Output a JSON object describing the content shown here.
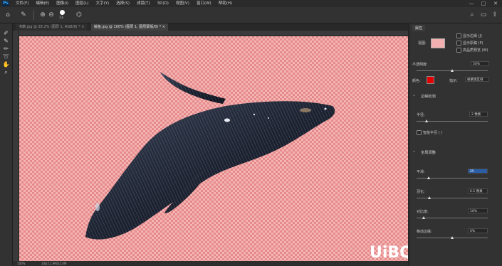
{
  "menubar": {
    "logo": "Ps",
    "items": [
      "文件(F)",
      "编辑(E)",
      "图像(I)",
      "图层(L)",
      "文字(Y)",
      "选择(S)",
      "滤镜(T)",
      "3D(D)",
      "视图(V)",
      "窗口(W)",
      "帮助(H)"
    ],
    "minimize": "—",
    "maximize": "□",
    "close": "✕"
  },
  "options": {
    "brush_size": "13"
  },
  "tabs": [
    {
      "label": "书籍.jpg @ 28.2% (图层 1, RGB/8) *",
      "close": "×"
    },
    {
      "label": "鲸鱼.jpg @ 100% (图层 1, 图层蒙版/8) *",
      "close": "×"
    }
  ],
  "status": {
    "zoom": "100%",
    "doc": "文档:11.9M/22.0M"
  },
  "properties": {
    "tab": "属性",
    "show_edge": "显示边缘 (J)",
    "show_original": "显示原稿 (P)",
    "hq_preview": "高品质预览 (W)",
    "view_label": "视图:",
    "opacity_label": "不透明度:",
    "opacity_value": "50%",
    "color_label": "颜色:",
    "indicates_label": "指示:",
    "indicates_value": "被蒙版区域",
    "edge_detection": "边缘检测",
    "radius_label": "半径:",
    "radius_value": "2 像素",
    "smart_radius": "智能半径 ( )",
    "global_refinement": "全局调整",
    "smooth_label": "平滑:",
    "smooth_value": "25",
    "feather_label": "羽化:",
    "feather_value": "6.5 像素",
    "contrast_label": "对比度:",
    "contrast_value": "10%",
    "shift_edge_label": "移动边缘:",
    "shift_edge_value": "0%",
    "mask_color": "#e40000"
  },
  "watermark": "UiBQ.CoM"
}
